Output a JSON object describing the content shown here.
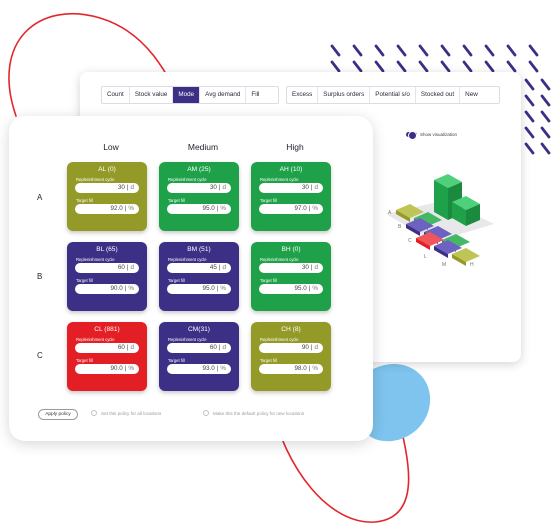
{
  "tabs_left": [
    "Count",
    "Stock value",
    "Mode",
    "Avg demand",
    "Fill"
  ],
  "tabs_right": [
    "Excess",
    "Surplus orders",
    "Potential s/o",
    "Stocked out",
    "New"
  ],
  "active_tab": "Mode",
  "visualization_toggle": {
    "label": "Show visualization",
    "on": true
  },
  "chart3d_labels": {
    "rows": [
      "A",
      "B",
      "C"
    ],
    "cols": [
      "L",
      "M",
      "H"
    ]
  },
  "columns": [
    "Low",
    "Medium",
    "High"
  ],
  "rows": [
    "A",
    "B",
    "C"
  ],
  "field_labels": {
    "cycle": "Replenishment cycle",
    "fill": "Target fill"
  },
  "units": {
    "cycle": "d",
    "fill": "%"
  },
  "cells": [
    {
      "title": "AL (0)",
      "cycle": "30",
      "fill": "92.0",
      "color": "#949a28"
    },
    {
      "title": "AM (25)",
      "cycle": "30",
      "fill": "95.0",
      "color": "#1ea149"
    },
    {
      "title": "AH (10)",
      "cycle": "30",
      "fill": "97.0",
      "color": "#1ea149"
    },
    {
      "title": "BL (65)",
      "cycle": "60",
      "fill": "90.0",
      "color": "#3b2f86"
    },
    {
      "title": "BM (51)",
      "cycle": "45",
      "fill": "95.0",
      "color": "#3b2f86"
    },
    {
      "title": "BH (0)",
      "cycle": "30",
      "fill": "95.0",
      "color": "#1ea149"
    },
    {
      "title": "CL (881)",
      "cycle": "60",
      "fill": "90.0",
      "color": "#e31e24"
    },
    {
      "title": "CM(31)",
      "cycle": "60",
      "fill": "93.0",
      "color": "#3b2f86"
    },
    {
      "title": "CH (8)",
      "cycle": "90",
      "fill": "98.0",
      "color": "#949a28"
    }
  ],
  "apply_button": "Apply policy",
  "options": [
    "Set this policy for all locations",
    "Make this the default policy for new locations"
  ],
  "accent_color": "#3b2f86"
}
